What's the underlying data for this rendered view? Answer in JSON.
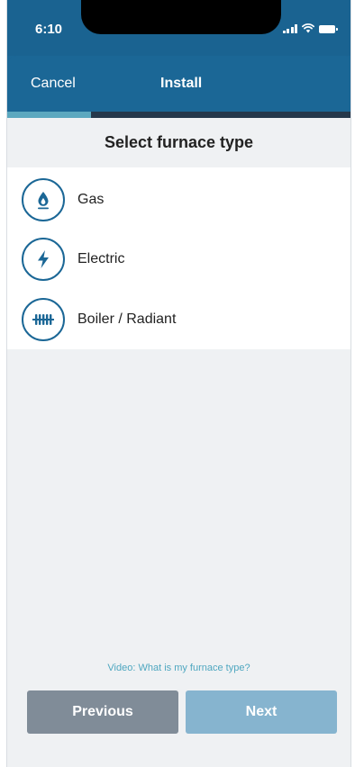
{
  "status_bar": {
    "time": "6:10"
  },
  "nav": {
    "cancel_label": "Cancel",
    "title": "Install"
  },
  "progress": {
    "fraction": 0.24
  },
  "section": {
    "title": "Select furnace type"
  },
  "options": [
    {
      "label": "Gas",
      "icon": "flame-drop-icon"
    },
    {
      "label": "Electric",
      "icon": "lightning-bolt-icon"
    },
    {
      "label": "Boiler / Radiant",
      "icon": "radiator-icon"
    }
  ],
  "help": {
    "video_link": "Video: What is my furnace type?"
  },
  "footer": {
    "previous_label": "Previous",
    "next_label": "Next"
  },
  "colors": {
    "header_blue": "#1b6796",
    "progress_fill": "#5ca8bf",
    "link_teal": "#4fa7c0",
    "button_previous": "#808c98",
    "button_next_disabled": "#86b4cf",
    "background_gray": "#eff1f3"
  }
}
